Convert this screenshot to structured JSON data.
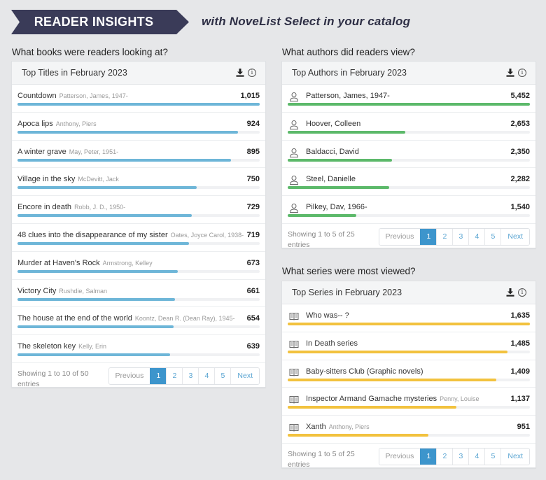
{
  "banner": {
    "title": "READER INSIGHTS",
    "tagline": "with NoveList Select in your catalog",
    "color": "#3a3b58"
  },
  "colors": {
    "titles_bar": "#6eb6d8",
    "authors_bar": "#5cb96a",
    "series_bar": "#f2c23e",
    "page_active": "#3d95cc"
  },
  "titles": {
    "question": "What books were readers looking at?",
    "header": "Top Titles in February 2023",
    "max": 1015,
    "rows": [
      {
        "title": "Countdown",
        "author": "Patterson, James, 1947-",
        "value": 1015,
        "display": "1,015"
      },
      {
        "title": "Apoca lips",
        "author": "Anthony, Piers",
        "value": 924,
        "display": "924"
      },
      {
        "title": "A winter grave",
        "author": "May, Peter, 1951-",
        "value": 895,
        "display": "895"
      },
      {
        "title": "Village in the sky",
        "author": "McDevitt, Jack",
        "value": 750,
        "display": "750"
      },
      {
        "title": "Encore in death",
        "author": "Robb, J. D., 1950-",
        "value": 729,
        "display": "729"
      },
      {
        "title": "48 clues into the disappearance of my sister",
        "author": "Oates, Joyce Carol, 1938-",
        "value": 719,
        "display": "719"
      },
      {
        "title": "Murder at Haven's Rock",
        "author": "Armstrong, Kelley",
        "value": 673,
        "display": "673"
      },
      {
        "title": "Victory City",
        "author": "Rushdie, Salman",
        "value": 661,
        "display": "661"
      },
      {
        "title": "The house at the end of the world",
        "author": "Koontz, Dean R. (Dean Ray), 1945-",
        "value": 654,
        "display": "654"
      },
      {
        "title": "The skeleton key",
        "author": "Kelly, Erin",
        "value": 639,
        "display": "639"
      }
    ],
    "showing": "Showing 1 to 10 of 50 entries",
    "pager": {
      "prev": "Previous",
      "pages": [
        "1",
        "2",
        "3",
        "4",
        "5"
      ],
      "active": "1",
      "next": "Next"
    }
  },
  "authors": {
    "question": "What authors did readers view?",
    "header": "Top Authors in February 2023",
    "max": 5452,
    "rows": [
      {
        "title": "Patterson, James, 1947-",
        "author": "",
        "value": 5452,
        "display": "5,452"
      },
      {
        "title": "Hoover, Colleen",
        "author": "",
        "value": 2653,
        "display": "2,653"
      },
      {
        "title": "Baldacci, David",
        "author": "",
        "value": 2350,
        "display": "2,350"
      },
      {
        "title": "Steel, Danielle",
        "author": "",
        "value": 2282,
        "display": "2,282"
      },
      {
        "title": "Pilkey, Dav, 1966-",
        "author": "",
        "value": 1540,
        "display": "1,540"
      }
    ],
    "showing": "Showing 1 to 5 of 25 entries",
    "pager": {
      "prev": "Previous",
      "pages": [
        "1",
        "2",
        "3",
        "4",
        "5"
      ],
      "active": "1",
      "next": "Next"
    }
  },
  "series": {
    "question": "What series were most viewed?",
    "header": "Top Series in February 2023",
    "max": 1635,
    "rows": [
      {
        "title": "Who was-- ?",
        "author": "",
        "value": 1635,
        "display": "1,635"
      },
      {
        "title": "In Death series",
        "author": "",
        "value": 1485,
        "display": "1,485"
      },
      {
        "title": "Baby-sitters Club (Graphic novels)",
        "author": "",
        "value": 1409,
        "display": "1,409"
      },
      {
        "title": "Inspector Armand Gamache mysteries",
        "author": "Penny, Louise",
        "value": 1137,
        "display": "1,137"
      },
      {
        "title": "Xanth",
        "author": "Anthony, Piers",
        "value": 951,
        "display": "951"
      }
    ],
    "showing": "Showing 1 to 5 of 25 entries",
    "pager": {
      "prev": "Previous",
      "pages": [
        "1",
        "2",
        "3",
        "4",
        "5"
      ],
      "active": "1",
      "next": "Next"
    }
  },
  "icons": {
    "download": "download-icon",
    "info": "info-icon",
    "author": "person-icon",
    "series": "book-icon"
  }
}
